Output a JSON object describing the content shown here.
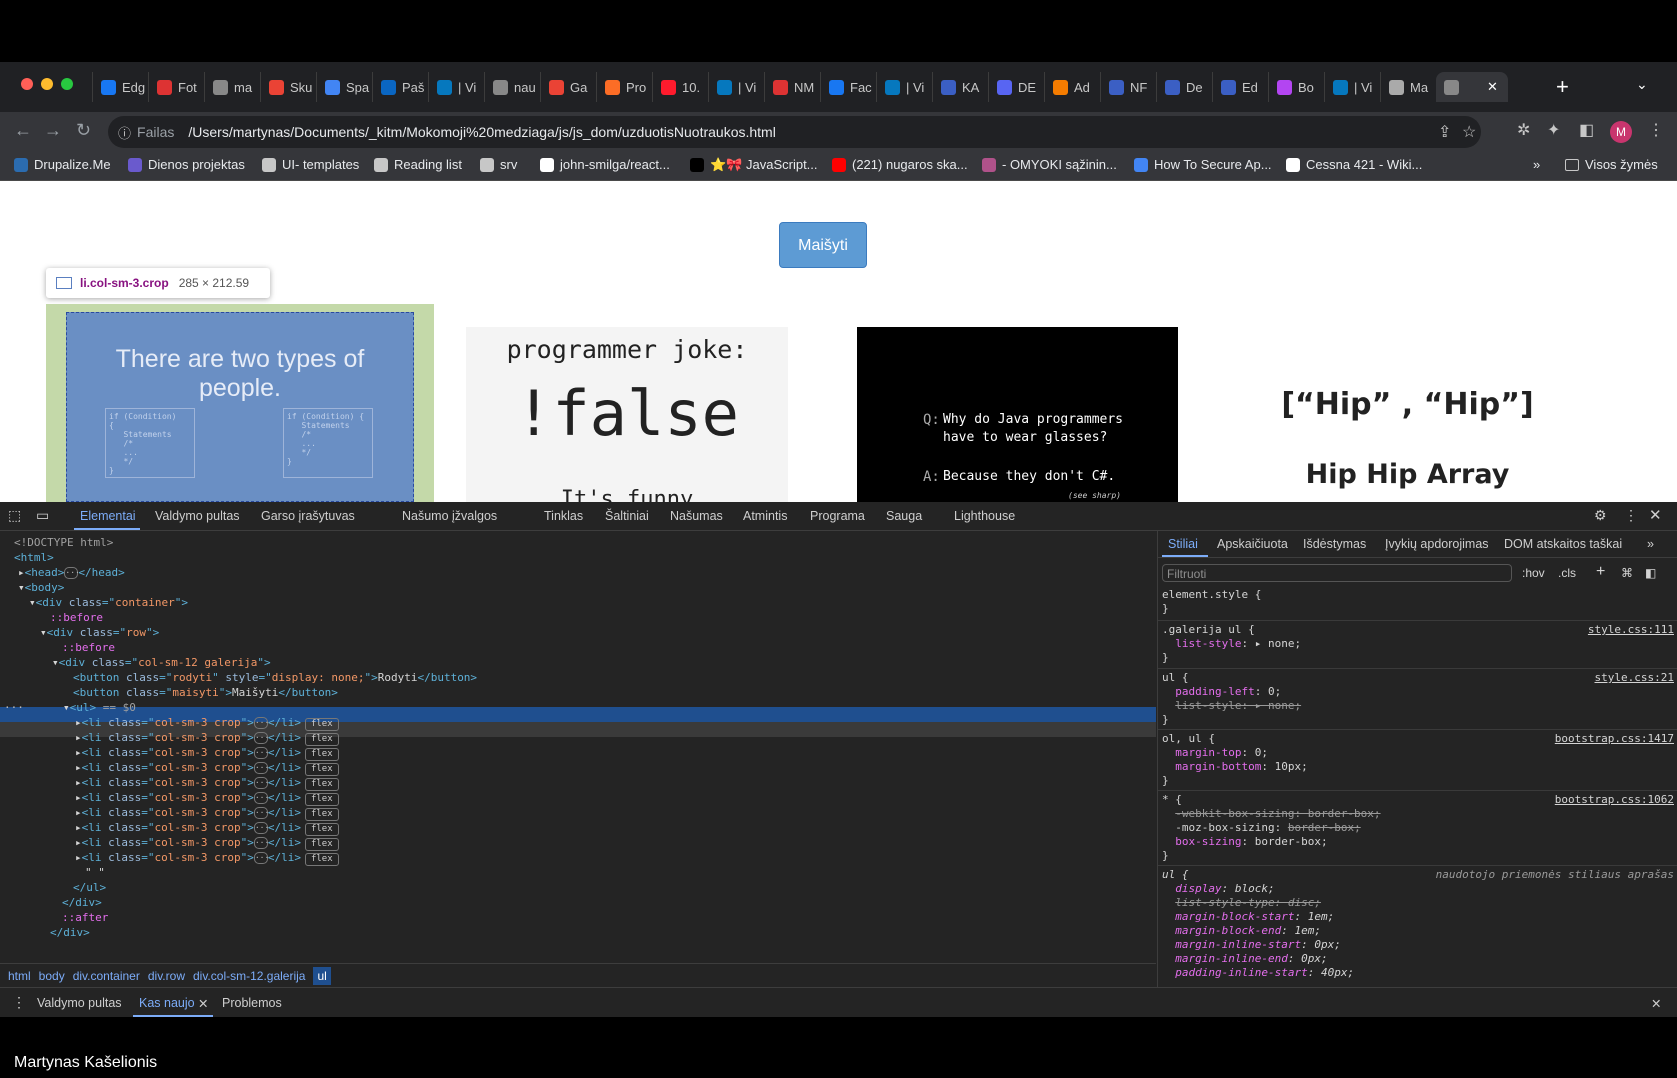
{
  "browser": {
    "tabs": [
      {
        "label": "Edg",
        "icon": "facebook-icon",
        "color": "#1877f2"
      },
      {
        "label": "Fot",
        "icon": "page-icon",
        "color": "#d33"
      },
      {
        "label": "ma",
        "icon": "globe-icon",
        "color": "#888"
      },
      {
        "label": "Sku",
        "icon": "gmail-icon",
        "color": "#ea4335"
      },
      {
        "label": "Spa",
        "icon": "puzzle-icon",
        "color": "#4285f4"
      },
      {
        "label": "Paš",
        "icon": "outlook-icon",
        "color": "#0a66c2"
      },
      {
        "label": "| Vi",
        "icon": "drupal-icon",
        "color": "#0678be"
      },
      {
        "label": "nau",
        "icon": "globe-icon",
        "color": "#888"
      },
      {
        "label": "Ga",
        "icon": "gmail-icon",
        "color": "#ea4335"
      },
      {
        "label": "Pro",
        "icon": "gitlab-icon",
        "color": "#fc6d26"
      },
      {
        "label": "10.",
        "icon": "opera-icon",
        "color": "#ff1b2d"
      },
      {
        "label": "| Vi",
        "icon": "drupal-icon",
        "color": "#0678be"
      },
      {
        "label": "NM",
        "icon": "page-icon",
        "color": "#d33"
      },
      {
        "label": "Fac",
        "icon": "facebook-icon",
        "color": "#1877f2"
      },
      {
        "label": "| Vi",
        "icon": "drupal-icon",
        "color": "#0678be"
      },
      {
        "label": "KA",
        "icon": "bookmark-icon",
        "color": "#3b5fc4"
      },
      {
        "label": "DE",
        "icon": "d-icon",
        "color": "#5865f2"
      },
      {
        "label": "Ad",
        "icon": "bar-icon",
        "color": "#f57c00"
      },
      {
        "label": "NF",
        "icon": "bookmark-icon",
        "color": "#3b5fc4"
      },
      {
        "label": "De",
        "icon": "bookmark-icon",
        "color": "#3b5fc4"
      },
      {
        "label": "Ed",
        "icon": "bookmark-icon",
        "color": "#3b5fc4"
      },
      {
        "label": "Bo",
        "icon": "phpstorm-icon",
        "color": "#b345f1"
      },
      {
        "label": "| Vi",
        "icon": "drupal-icon",
        "color": "#0678be"
      },
      {
        "label": "Ma",
        "icon": "m-icon",
        "color": "#aaa"
      },
      {
        "label": "",
        "icon": "globe-icon",
        "color": "#888",
        "active": true
      }
    ],
    "new_tab": "+",
    "address": {
      "protocol_label": "Failas",
      "url": "/Users/martynas/Documents/_kitm/Mokomoji%20medziaga/js/js_dom/uzduotisNuotraukos.html"
    },
    "avatar_letter": "M",
    "bookmarks": [
      {
        "label": "Drupalize.Me",
        "icon": "drop-icon",
        "color": "#2b6cb0"
      },
      {
        "label": "Dienos projektas",
        "icon": "app-icon",
        "color": "#6a5acd"
      },
      {
        "label": "UI- templates",
        "icon": "folder-icon",
        "color": "#c7c7c7"
      },
      {
        "label": "Reading list",
        "icon": "folder-icon",
        "color": "#c7c7c7"
      },
      {
        "label": "srv",
        "icon": "folder-icon",
        "color": "#c7c7c7"
      },
      {
        "label": "john-smilga/react...",
        "icon": "github-icon",
        "color": "#fff"
      },
      {
        "label": "⭐🎀 JavaScript...",
        "icon": "dev-icon",
        "color": "#000"
      },
      {
        "label": "(221) nugaros ska...",
        "icon": "youtube-icon",
        "color": "#ff0000"
      },
      {
        "label": "- OMYOKI sąžinin...",
        "icon": "gear-icon",
        "color": "#b0528a"
      },
      {
        "label": "How To Secure Ap...",
        "icon": "refresh-icon",
        "color": "#4285f4"
      },
      {
        "label": "Cessna 421 - Wiki...",
        "icon": "wikipedia-icon",
        "color": "#fff"
      }
    ],
    "bookmarks_more": "»",
    "all_bookmarks": "Visos žymės"
  },
  "page": {
    "shuffle_button": "Maišyti",
    "tooltip": {
      "selector": "li.col-sm-3.crop",
      "size": "285 × 212.59"
    },
    "images": {
      "img1_title": "There are two types of people.",
      "img1_code_a": "if (Condition)\n{\n   Statements\n   /*\n   ...\n   */\n}",
      "img1_code_b": "if (Condition) {\n   Statements\n   /*\n   ...\n   */\n}",
      "img2_line1": "programmer joke:",
      "img2_line2": "!false",
      "img2_line3": "It's funny",
      "img3_q_label": "Q:",
      "img3_q": "Why do Java programmers\nhave to wear glasses?",
      "img3_a_label": "A:",
      "img3_a": "Because they don't C#.",
      "img3_note": "(see sharp)",
      "img4_line1": "[“Hip” , “Hip”]",
      "img4_line2": "Hip Hip Array"
    }
  },
  "devtools": {
    "tabs": [
      "Elementai",
      "Valdymo pultas",
      "Garso įrašytuvas",
      "Našumo įžvalgos",
      "Tinklas",
      "Šaltiniai",
      "Našumas",
      "Atmintis",
      "Programa",
      "Sauga",
      "Lighthouse"
    ],
    "dom": {
      "doctype": "<!DOCTYPE html>",
      "html": "html",
      "head": "head",
      "body": "body",
      "container_class": "container",
      "row_class": "row",
      "before": "::before",
      "after": "::after",
      "gallery_class": "col-sm-12 galerija",
      "btn1_class": "rodyti",
      "btn1_style": "display: none;",
      "btn1_text": "Rodyti",
      "btn2_class": "maisyti",
      "btn2_text": "Maišyti",
      "ul": "ul",
      "ul_ref": "== $0",
      "li_class": "col-sm-3 crop",
      "flex_badge": "flex",
      "text_node": "\" \"",
      "div": "div"
    },
    "breadcrumb": [
      "html",
      "body",
      "div.container",
      "div.row",
      "div.col-sm-12.galerija",
      "ul"
    ],
    "styles_tabs": [
      "Stiliai",
      "Apskaičiuota",
      "Išdėstymas",
      "Įvykių apdorojimas",
      "DOM atskaitos taškai",
      "»"
    ],
    "filter_placeholder": "Filtruoti",
    "filter_buttons": [
      ":hov",
      ".cls"
    ],
    "rules": {
      "r1_selector": "element.style {",
      "r2_selector": ".galerija ul {",
      "r2_src": "style.css:111",
      "r2_p1": "list-style",
      "r2_v1": "▸ none;",
      "r3_selector": "ul {",
      "r3_src": "style.css:21",
      "r3_p1": "padding-left",
      "r3_v1": "0;",
      "r3_p2": "list-style: ▸ none;",
      "r4_selector": "ol, ul {",
      "r4_src": "bootstrap.css:1417",
      "r4_p1": "margin-top",
      "r4_v1": "0;",
      "r4_p2": "margin-bottom",
      "r4_v2": "10px;",
      "r5_selector": "* {",
      "r5_src": "bootstrap.css:1062",
      "r5_p1": "-webkit-box-sizing: border-box;",
      "r5_p2": "-moz-box-sizing",
      "r5_v2": "border-box;",
      "r5_p3": "box-sizing",
      "r5_v3": "border-box;",
      "r6_selector": "ul {",
      "r6_src": "naudotojo priemonės stiliaus aprašas",
      "r6_p1": "display",
      "r6_v1": "block;",
      "r6_p2": "list-style-type: disc;",
      "r6_p3": "margin-block-start",
      "r6_v3": "1em;",
      "r6_p4": "margin-block-end",
      "r6_v4": "1em;",
      "r6_p5": "margin-inline-start",
      "r6_v5": "0px;",
      "r6_p6": "margin-inline-end",
      "r6_v6": "0px;",
      "r6_p7": "padding-inline-start",
      "r6_v7": "40px;",
      "close_brace": "}"
    },
    "drawer_tabs": [
      "Valdymo pultas",
      "Kas naujo",
      "Problemos"
    ]
  },
  "caption": "Martynas Kašelionis"
}
